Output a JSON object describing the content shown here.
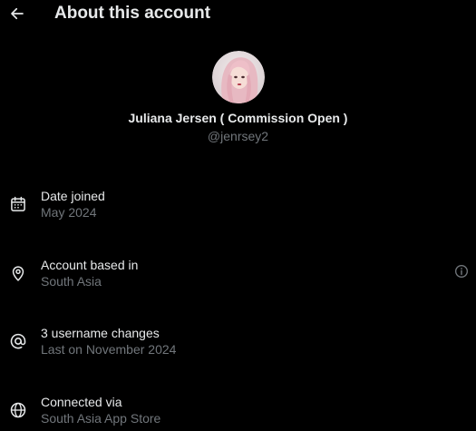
{
  "header": {
    "title": "About this account"
  },
  "profile": {
    "display_name": "Juliana Jersen ( Commission Open )",
    "handle": "@jenrsey2"
  },
  "rows": [
    {
      "title": "Date joined",
      "subtitle": "May 2024",
      "icon": "calendar-icon"
    },
    {
      "title": "Account based in",
      "subtitle": "South Asia",
      "icon": "location-pin-icon"
    },
    {
      "title": "3 username changes",
      "subtitle": "Last on November 2024",
      "icon": "at-sign-icon"
    },
    {
      "title": "Connected via",
      "subtitle": "South Asia App Store",
      "icon": "globe-icon"
    }
  ],
  "colors": {
    "background": "#000000",
    "primary_text": "#e7e9ea",
    "secondary_text": "#71767b"
  }
}
